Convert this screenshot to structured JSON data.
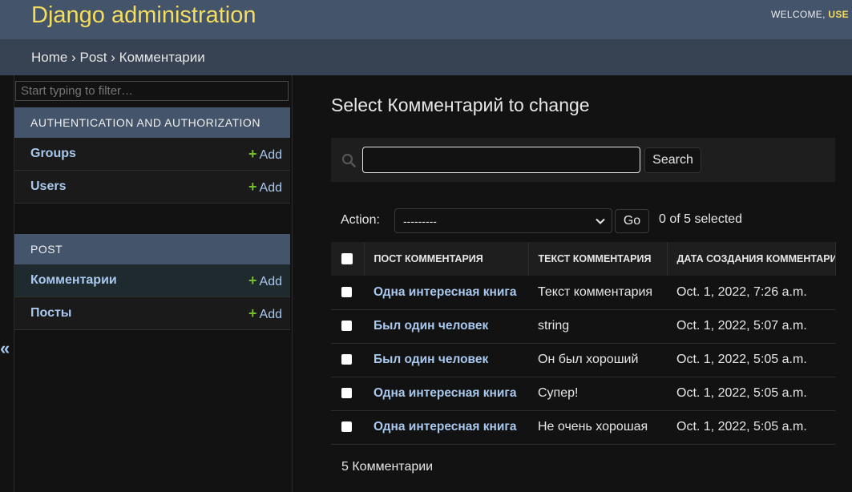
{
  "header": {
    "site_name": "Django administration",
    "welcome": "WELCOME,",
    "user": "USE"
  },
  "breadcrumbs": {
    "home": "Home",
    "app": "Post",
    "model": "Комментарии",
    "separator": "›"
  },
  "sidebar": {
    "filter_placeholder": "Start typing to filter…",
    "collapse_toggle": "«",
    "modules": [
      {
        "caption": "AUTHENTICATION AND AUTHORIZATION",
        "models": [
          {
            "name": "Groups",
            "add": "Add"
          },
          {
            "name": "Users",
            "add": "Add"
          }
        ]
      },
      {
        "caption": "POST",
        "models": [
          {
            "name": "Комментарии",
            "add": "Add",
            "current": true
          },
          {
            "name": "Посты",
            "add": "Add"
          }
        ]
      }
    ]
  },
  "content": {
    "title": "Select Комментарий to change",
    "search": {
      "value": "",
      "button": "Search",
      "icon": "search-icon"
    },
    "actions": {
      "label": "Action:",
      "selected": "---------",
      "go": "Go",
      "counter": "0 of 5 selected"
    },
    "table": {
      "columns": [
        "ПОСТ КОММЕНТАРИЯ",
        "ТЕКСТ КОММЕНТАРИЯ",
        "ДАТА СОЗДАНИЯ КОММЕНТАРИЯ"
      ],
      "rows": [
        [
          "Одна интересная книга",
          "Текст комментария",
          "Oct. 1, 2022, 7:26 a.m."
        ],
        [
          "Был один человек",
          "string",
          "Oct. 1, 2022, 5:07 a.m."
        ],
        [
          "Был один человек",
          "Он был хороший",
          "Oct. 1, 2022, 5:05 a.m."
        ],
        [
          "Одна интересная книга",
          "Супер!",
          "Oct. 1, 2022, 5:05 a.m."
        ],
        [
          "Одна интересная книга",
          "Не очень хорошая",
          "Oct. 1, 2022, 5:05 a.m."
        ]
      ]
    },
    "paginator": "5 Комментарии"
  },
  "colors": {
    "header_bg": "#44546a",
    "breadcrumbs_bg": "#374353",
    "site_name": "#f5dd5d",
    "link": "#a9c8ee",
    "add_plus": "#70bf2b",
    "page_bg": "#121212"
  }
}
